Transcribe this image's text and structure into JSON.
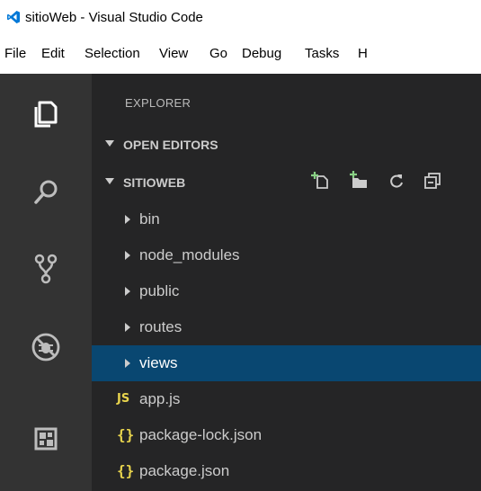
{
  "window": {
    "title": "sitioWeb - Visual Studio Code",
    "accent_color": "#0078d7"
  },
  "menubar": {
    "items": [
      "File",
      "Edit",
      "Selection",
      "View",
      "Go",
      "Debug",
      "Tasks",
      "H"
    ]
  },
  "activity_bar": {
    "icons": [
      "explorer-icon",
      "search-icon",
      "source-control-icon",
      "debug-icon",
      "extensions-icon"
    ],
    "background": "#333333"
  },
  "sidebar": {
    "title": "EXPLORER",
    "sections": {
      "open_editors": "OPEN EDITORS",
      "project": "SITIOWEB"
    },
    "toolbar": [
      "new-file-icon",
      "new-folder-icon",
      "refresh-icon",
      "collapse-all-icon"
    ],
    "folders": [
      "bin",
      "node_modules",
      "public",
      "routes",
      "views"
    ],
    "selected_folder": "views",
    "files": [
      {
        "badge": "JS",
        "name": "app.js"
      },
      {
        "badge": "{}",
        "name": "package-lock.json"
      },
      {
        "badge": "{}",
        "name": "package.json"
      }
    ],
    "selection_color": "#094771",
    "background": "#252526"
  }
}
